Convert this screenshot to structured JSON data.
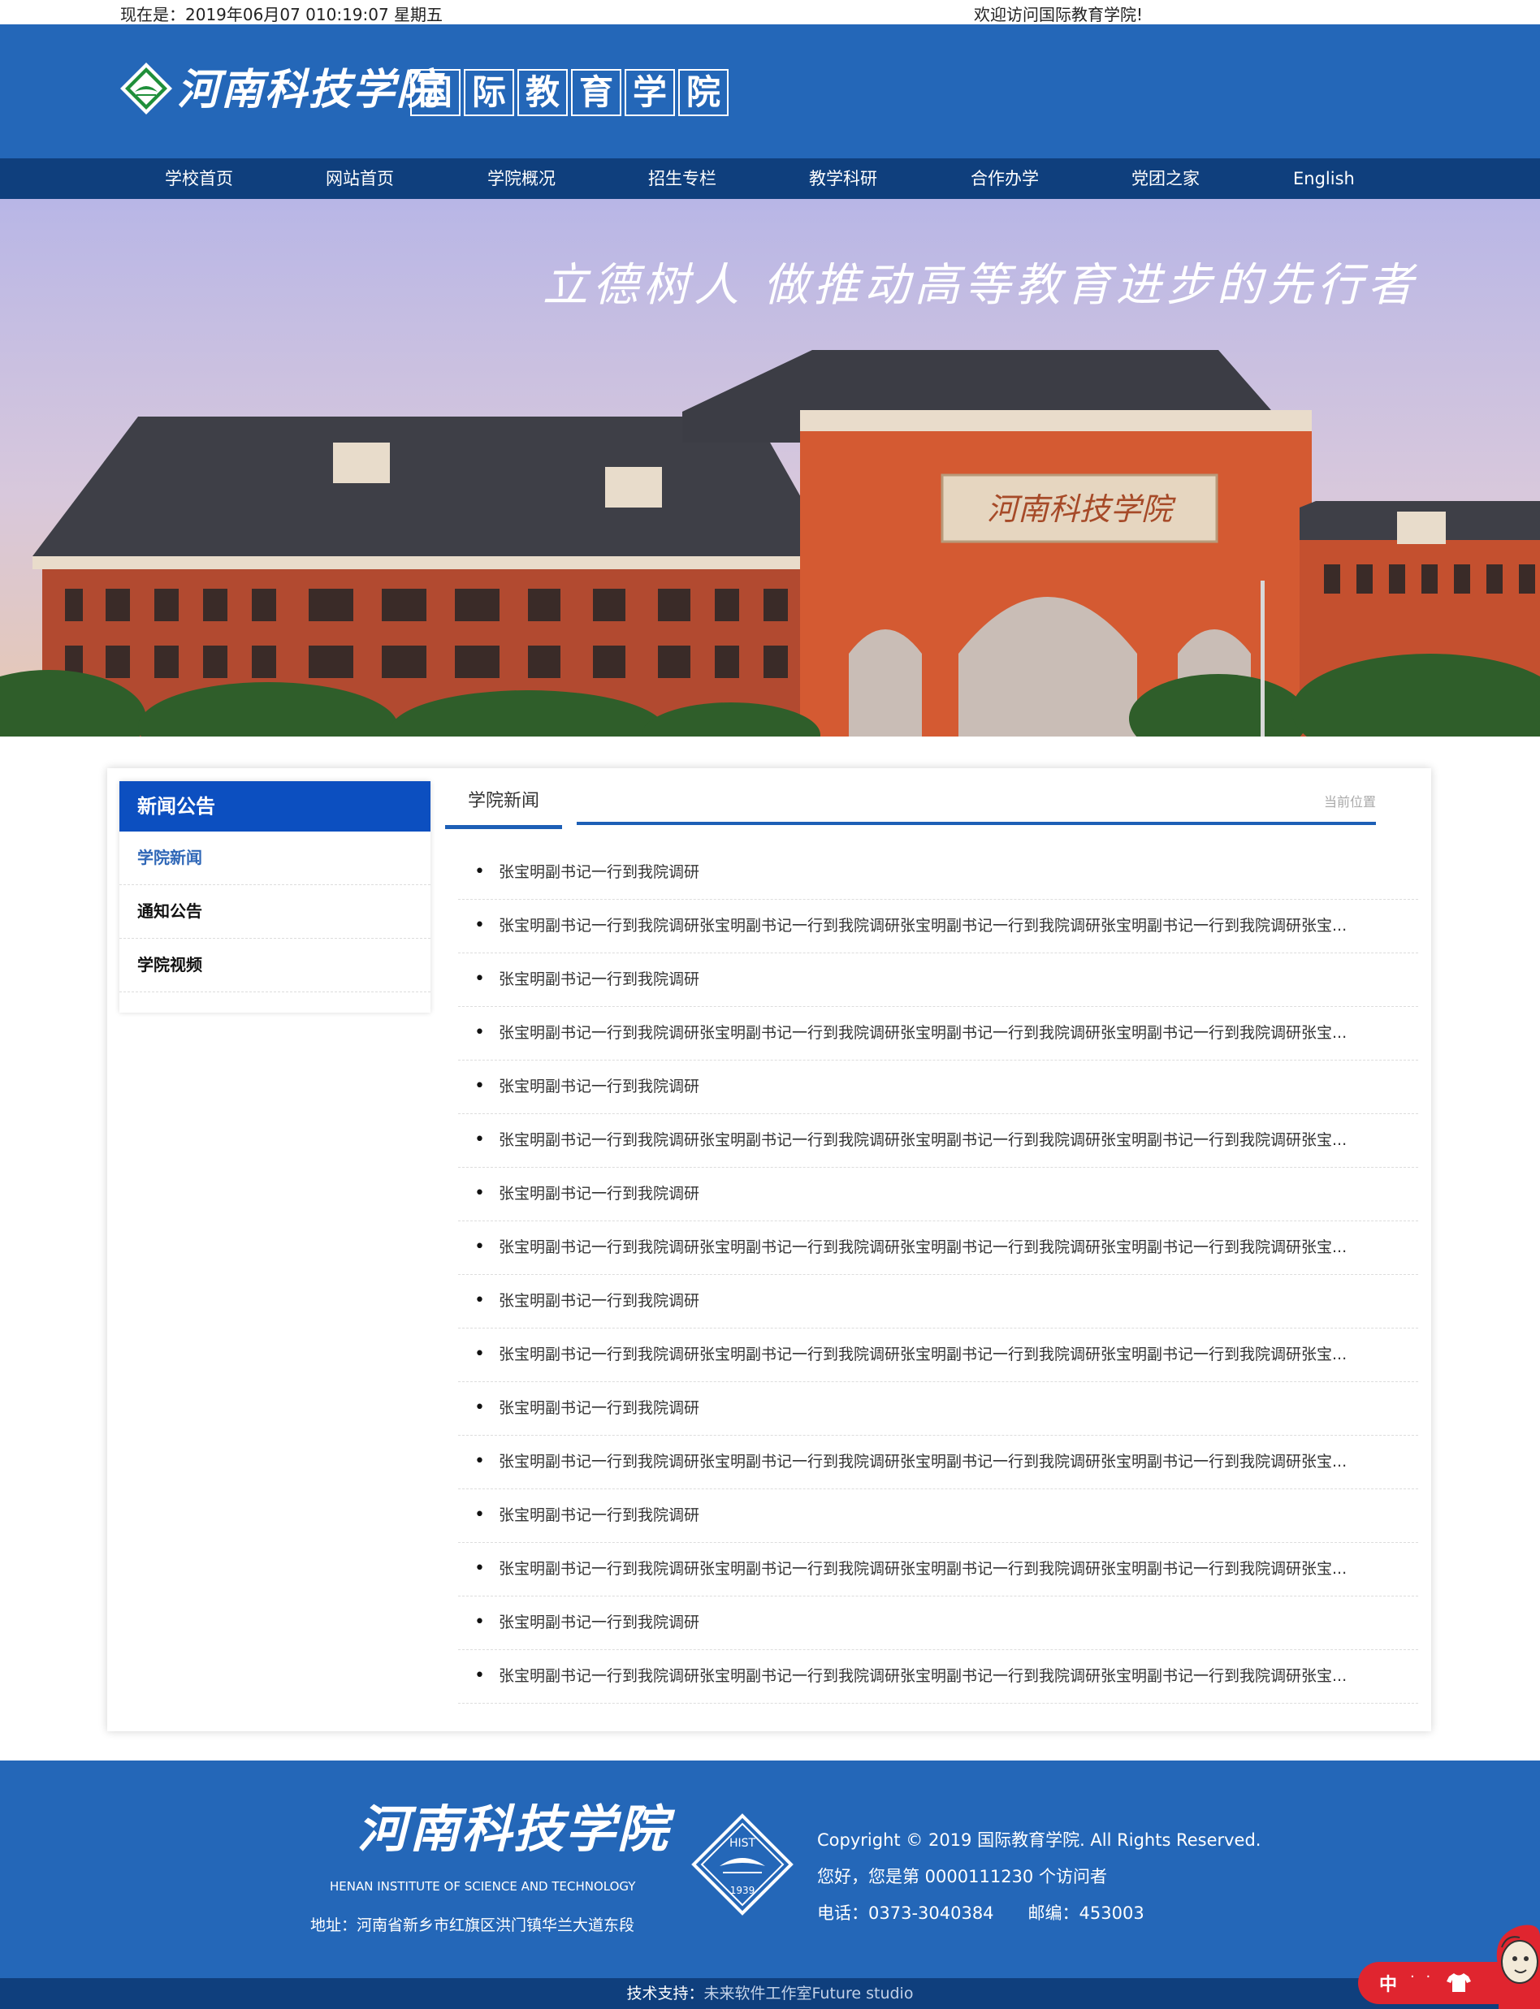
{
  "topbar": {
    "datetime": "现在是：2019年06月07 010:19:07 星期五",
    "welcome": "欢迎访问国际教育学院!"
  },
  "header": {
    "school_name": "河南科技学院",
    "college_name": [
      "国",
      "际",
      "教",
      "育",
      "学",
      "院"
    ]
  },
  "nav": {
    "items": [
      "学校首页",
      "网站首页",
      "学院概况",
      "招生专栏",
      "教学科研",
      "合作办学",
      "党团之家",
      "English"
    ]
  },
  "banner": {
    "slogan": "立德树人 做推动高等教育进步的先行者",
    "building_sign": "河南科技学院"
  },
  "sidebar": {
    "title": "新闻公告",
    "items": [
      {
        "label": "学院新闻",
        "active": true
      },
      {
        "label": "通知公告",
        "active": false
      },
      {
        "label": "学院视频",
        "active": false
      }
    ]
  },
  "main": {
    "tab": "学院新闻",
    "location": "当前位置",
    "news": [
      "张宝明副书记一行到我院调研",
      "张宝明副书记一行到我院调研张宝明副书记一行到我院调研张宝明副书记一行到我院调研张宝明副书记一行到我院调研张宝...",
      "张宝明副书记一行到我院调研",
      "张宝明副书记一行到我院调研张宝明副书记一行到我院调研张宝明副书记一行到我院调研张宝明副书记一行到我院调研张宝...",
      "张宝明副书记一行到我院调研",
      "张宝明副书记一行到我院调研张宝明副书记一行到我院调研张宝明副书记一行到我院调研张宝明副书记一行到我院调研张宝...",
      "张宝明副书记一行到我院调研",
      "张宝明副书记一行到我院调研张宝明副书记一行到我院调研张宝明副书记一行到我院调研张宝明副书记一行到我院调研张宝...",
      "张宝明副书记一行到我院调研",
      "张宝明副书记一行到我院调研张宝明副书记一行到我院调研张宝明副书记一行到我院调研张宝明副书记一行到我院调研张宝...",
      "张宝明副书记一行到我院调研",
      "张宝明副书记一行到我院调研张宝明副书记一行到我院调研张宝明副书记一行到我院调研张宝明副书记一行到我院调研张宝...",
      "张宝明副书记一行到我院调研",
      "张宝明副书记一行到我院调研张宝明副书记一行到我院调研张宝明副书记一行到我院调研张宝明副书记一行到我院调研张宝...",
      "张宝明副书记一行到我院调研",
      "张宝明副书记一行到我院调研张宝明副书记一行到我院调研张宝明副书记一行到我院调研张宝明副书记一行到我院调研张宝..."
    ]
  },
  "footer": {
    "school_name": "河南科技学院",
    "school_name_en": "HENAN INSTITUTE OF SCIENCE AND TECHNOLOGY",
    "address": "地址：河南省新乡市红旗区洪门镇华兰大道东段",
    "copyright": "Copyright © 2019 国际教育学院. All Rights Reserved.",
    "visitors": "您好，您是第 0000111230 个访问者",
    "contact": "电话：0373-3040384　　邮编：453003",
    "emblem_text": "HIST",
    "emblem_year": "1939",
    "tech_label": "技术支持：",
    "tech_studio": "未来软件工作室Future studio"
  },
  "widget": {
    "lang": "中",
    "dots": "· ·"
  },
  "colors": {
    "header_blue": "#2467b8",
    "nav_dark": "#0f3f7d",
    "sidebar_title": "#0c4fc0",
    "accent_red": "#e0252f"
  }
}
